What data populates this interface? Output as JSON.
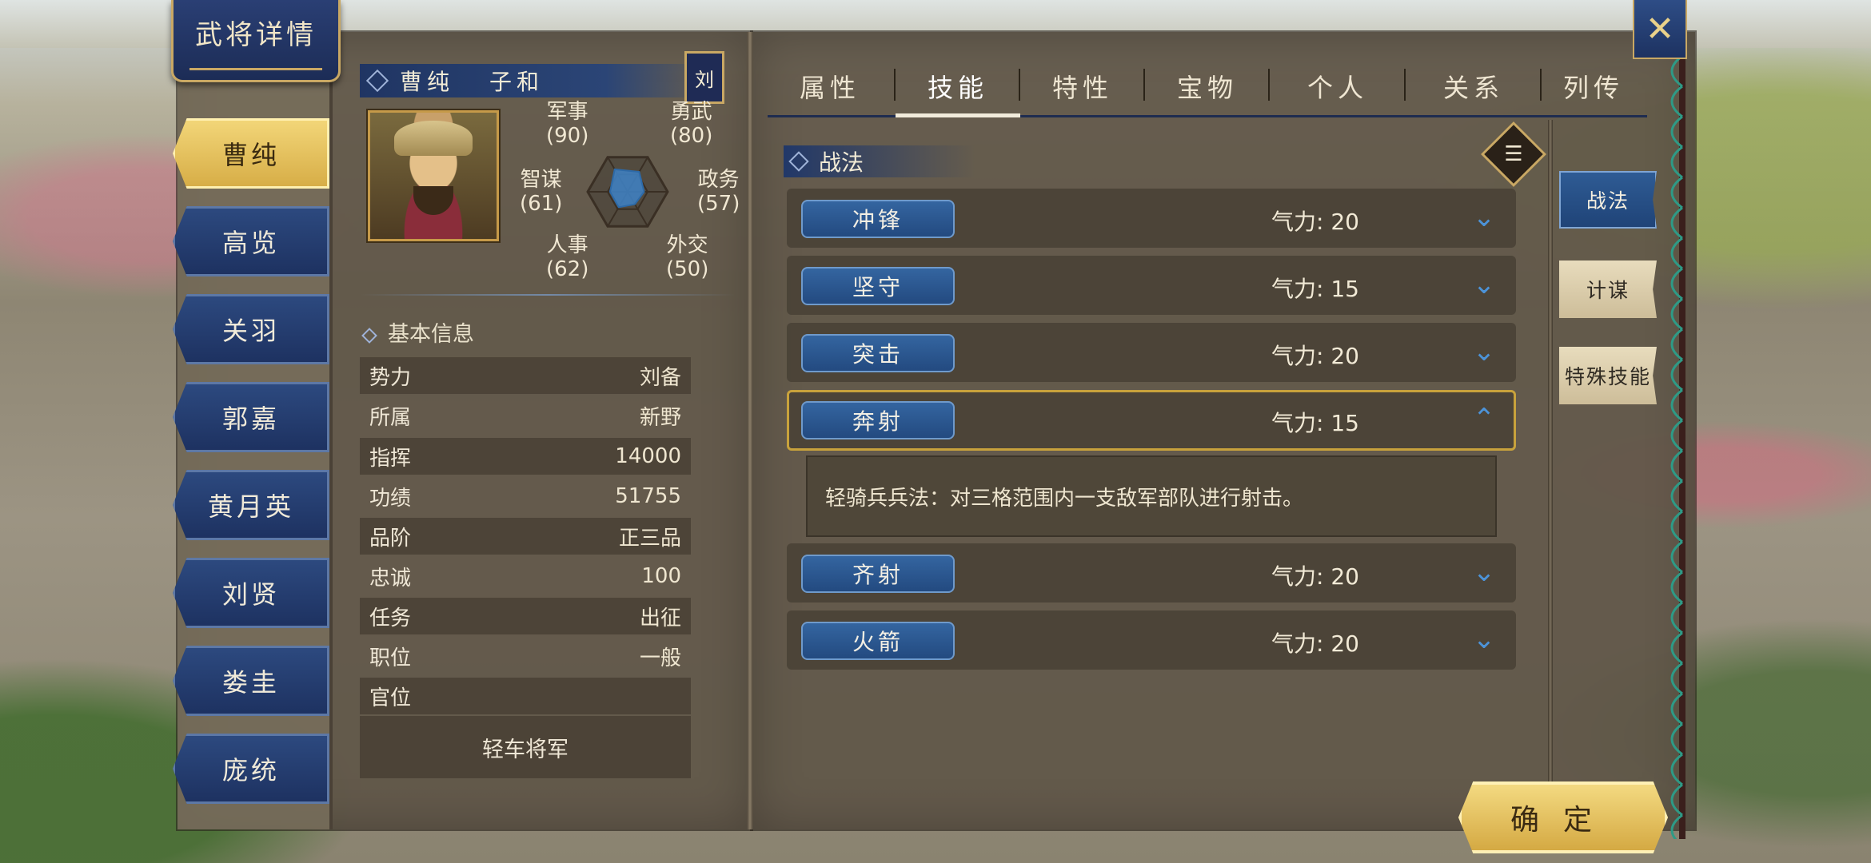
{
  "window": {
    "title": "武将详情"
  },
  "generals": [
    {
      "name": "曹纯",
      "active": true
    },
    {
      "name": "高览",
      "active": false
    },
    {
      "name": "关羽",
      "active": false
    },
    {
      "name": "郭嘉",
      "active": false
    },
    {
      "name": "黄月英",
      "active": false
    },
    {
      "name": "刘贤",
      "active": false
    },
    {
      "name": "娄圭",
      "active": false
    },
    {
      "name": "庞统",
      "active": false
    }
  ],
  "profile": {
    "name": "曹纯",
    "courtesy_name": "子和",
    "faction_tag": "刘",
    "stats": {
      "military": {
        "label": "军事",
        "value": "(90)"
      },
      "valor": {
        "label": "勇武",
        "value": "(80)"
      },
      "strategy": {
        "label": "智谋",
        "value": "(61)"
      },
      "politics": {
        "label": "政务",
        "value": "(57)"
      },
      "personnel": {
        "label": "人事",
        "value": "(62)"
      },
      "diplomacy": {
        "label": "外交",
        "value": "(50)"
      }
    },
    "stat_values": {
      "military": 90,
      "valor": 80,
      "politics": 57,
      "diplomacy": 50,
      "personnel": 62,
      "strategy": 61
    }
  },
  "basic_info": {
    "title": "基本信息",
    "rows": [
      {
        "label": "势力",
        "value": "刘备"
      },
      {
        "label": "所属",
        "value": "新野"
      },
      {
        "label": "指挥",
        "value": "14000"
      },
      {
        "label": "功绩",
        "value": "51755"
      },
      {
        "label": "品阶",
        "value": "正三品"
      },
      {
        "label": "忠诚",
        "value": "100"
      },
      {
        "label": "任务",
        "value": "出征"
      },
      {
        "label": "职位",
        "value": "一般"
      },
      {
        "label": "官位",
        "value": ""
      }
    ],
    "official_title": "轻车将军"
  },
  "tabs": [
    {
      "label": "属性",
      "active": false
    },
    {
      "label": "技能",
      "active": true
    },
    {
      "label": "特性",
      "active": false
    },
    {
      "label": "宝物",
      "active": false
    },
    {
      "label": "个人",
      "active": false
    },
    {
      "label": "关系",
      "active": false
    },
    {
      "label": "列传",
      "active": false
    }
  ],
  "skills_section": {
    "title": "战法",
    "menu_icon": "list-icon",
    "skills": [
      {
        "name": "冲锋",
        "cost": "气力: 20",
        "expanded": false,
        "chevron": "chevron-down-icon"
      },
      {
        "name": "坚守",
        "cost": "气力: 15",
        "expanded": false,
        "chevron": "chevron-down-icon"
      },
      {
        "name": "突击",
        "cost": "气力: 20",
        "expanded": false,
        "chevron": "chevron-down-icon"
      },
      {
        "name": "奔射",
        "cost": "气力: 15",
        "expanded": true,
        "chevron": "chevron-up-icon",
        "description": "轻骑兵兵法：对三格范围内一支敌军部队进行射击。"
      },
      {
        "name": "齐射",
        "cost": "气力: 20",
        "expanded": false,
        "chevron": "chevron-down-icon"
      },
      {
        "name": "火箭",
        "cost": "气力: 20",
        "expanded": false,
        "chevron": "chevron-down-icon"
      }
    ]
  },
  "side_tabs": [
    {
      "label": "战法",
      "active": true
    },
    {
      "label": "计谋",
      "active": false
    },
    {
      "label": "特殊技能",
      "active": false
    }
  ],
  "buttons": {
    "close_icon": "close-icon",
    "confirm_label": "确定"
  },
  "colors": {
    "accent_gold": "#c9a864",
    "accent_blue": "#234a80",
    "chevron_blue": "#4c93d8"
  }
}
